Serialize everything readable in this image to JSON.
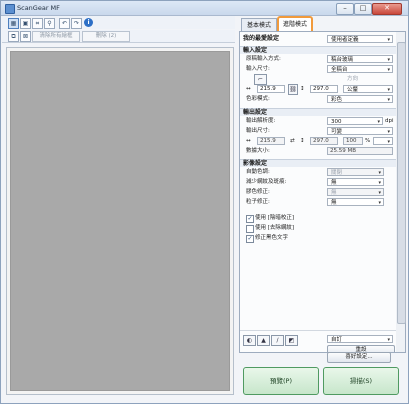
{
  "window": {
    "title": "ScanGear MF",
    "minimize": "–",
    "maximize": "□",
    "close": "✕"
  },
  "toolbar": {
    "icons": [
      "thumbnail-view-icon",
      "whole-image-view-icon",
      "crop-icon",
      "zoom-icon",
      "rotate-left-icon",
      "rotate-right-icon",
      "info-icon"
    ],
    "clear_all_frames": "清除所有繪框",
    "delete": "刪除 (2)"
  },
  "tabs": {
    "basic": "基本模式",
    "advanced": "進階模式"
  },
  "favorites": {
    "label": "我的最愛設定",
    "value": "使用者定義"
  },
  "input_settings": {
    "title": "輸入設定",
    "paper_source_label": "原稿輸入方式:",
    "paper_source_value": "稿台玻璃",
    "input_size_label": "輸入尺寸:",
    "input_size_value": "全稿台",
    "direction_label": "方向",
    "width": "215.9",
    "height": "297.0",
    "unit": "公釐",
    "color_mode_label": "色彩模式:",
    "color_mode_value": "彩色"
  },
  "output_settings": {
    "title": "輸出設定",
    "resolution_label": "輸出解析度:",
    "resolution_value": "300",
    "resolution_unit": "dpi",
    "output_size_label": "輸出尺寸:",
    "output_size_value": "可變",
    "width": "215.9",
    "height": "297.0",
    "scale": "100",
    "scale_unit": "%",
    "data_size_label": "數據大小:",
    "data_size_value": "25.59 MB"
  },
  "image_settings": {
    "title": "影像設定",
    "auto_tone_label": "自動色調:",
    "auto_tone_value": "關閉",
    "descreen_label": "減少網紋及斑痕:",
    "descreen_value": "無",
    "color_correction_label": "膠色修正:",
    "color_correction_value": "無",
    "grain_label": "粒子修正:",
    "grain_value": "無"
  },
  "checkboxes": [
    {
      "label": "使用 [陰暗校正]",
      "checked": true
    },
    {
      "label": "使用 [去除網紋]",
      "checked": false
    },
    {
      "label": "修正黑色文字",
      "checked": true
    }
  ],
  "adjust": {
    "icons": [
      "brightness-icon",
      "histogram-icon",
      "tone-curve-icon",
      "threshold-icon"
    ],
    "preset_value": "自訂",
    "reset_label": "重設"
  },
  "env_settings_label": "喜好設定...",
  "preview_button": "預覽(P)",
  "scan_button": "掃描(S)"
}
